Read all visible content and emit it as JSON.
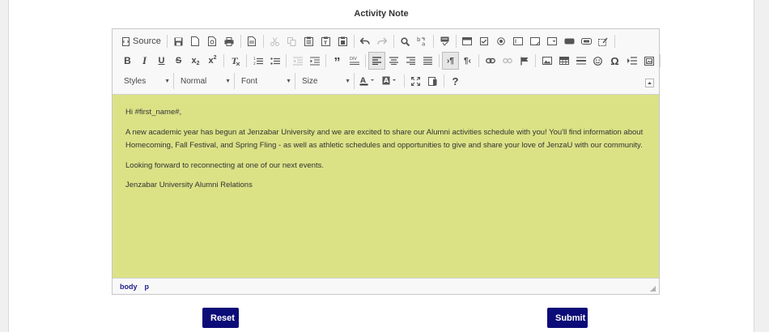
{
  "title": "Activity Note",
  "toolbar": {
    "source_label": "Source",
    "styles_label": "Styles",
    "format_label": "Normal",
    "font_label": "Font",
    "size_label": "Size"
  },
  "content": {
    "paragraphs": [
      "Hi #first_name#,",
      "A new academic year has begun at Jenzabar University and we are excited to share our Alumni activities schedule with you! You'll find information about Homecoming, Fall Festival, and Spring Fling - as well as athletic schedules and opportunities to give and share your love of JenzaU with our community.",
      "Looking forward to reconnecting at one of our next events.",
      "Jenzabar University Alumni Relations"
    ],
    "background_color": "#dbe286"
  },
  "statusbar": {
    "path": [
      "body",
      "p"
    ]
  },
  "buttons": {
    "reset_label": "Reset",
    "submit_label": "Submit",
    "color": "#0c0c78"
  }
}
